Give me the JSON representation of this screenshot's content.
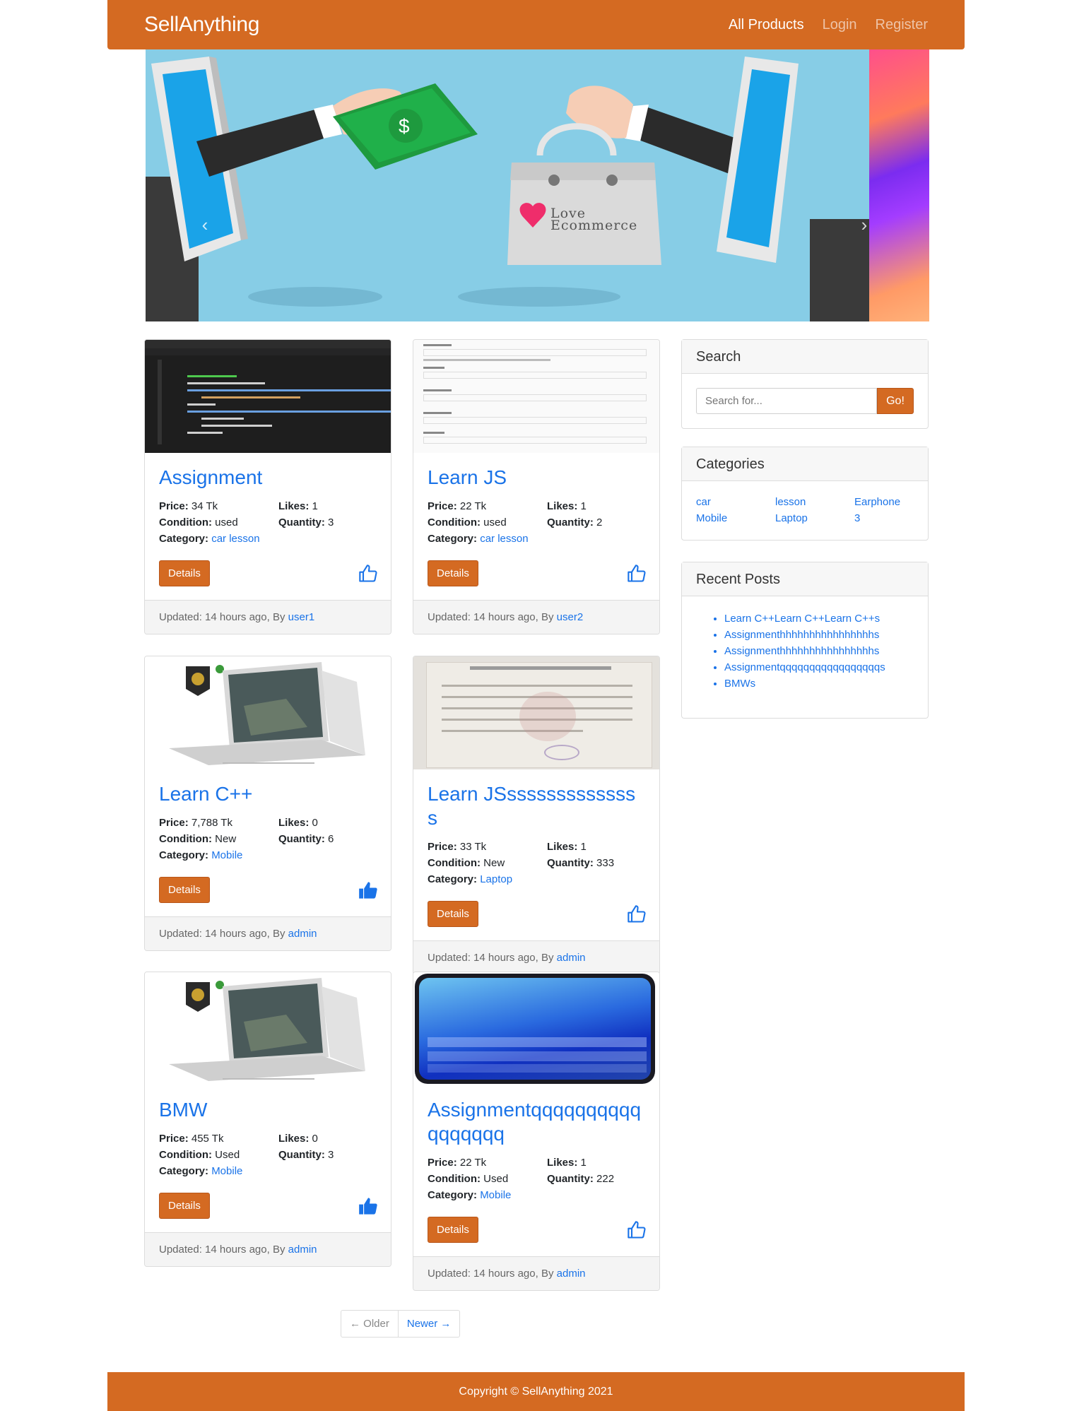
{
  "nav": {
    "brand": "SellAnything",
    "links": [
      "All Products",
      "Login",
      "Register"
    ]
  },
  "carousel": {
    "bag_text_line1": "Love",
    "bag_text_line2": "Ecommerce",
    "prev": "‹",
    "next": "›"
  },
  "labels": {
    "price": "Price:",
    "likes": "Likes:",
    "condition": "Condition:",
    "quantity": "Quantity:",
    "category": "Category:",
    "details": "Details",
    "updated_prefix": "Updated: 14 hours ago, By"
  },
  "products": [
    {
      "title": "Assignment",
      "price": "34 Tk",
      "likes": "1",
      "condition": "used",
      "quantity": "3",
      "category": "car lesson",
      "author": "user1",
      "liked": false,
      "image": "code-editor"
    },
    {
      "title": "Learn JS",
      "price": "22 Tk",
      "likes": "1",
      "condition": "used",
      "quantity": "2",
      "category": "car lesson",
      "author": "user2",
      "liked": false,
      "image": "signup-form"
    },
    {
      "title": "Learn C++",
      "price": "7,788 Tk",
      "likes": "0",
      "condition": "New",
      "quantity": "6",
      "category": "Mobile",
      "author": "admin",
      "liked": true,
      "image": "laptop"
    },
    {
      "title": "Learn JSssssssssssssss",
      "price": "33 Tk",
      "likes": "1",
      "condition": "New",
      "quantity": "333",
      "category": "Laptop",
      "author": "admin",
      "liked": false,
      "image": "certificate"
    },
    {
      "title": "BMW",
      "price": "455 Tk",
      "likes": "0",
      "condition": "Used",
      "quantity": "3",
      "category": "Mobile",
      "author": "admin",
      "liked": true,
      "image": "laptop"
    },
    {
      "title": "Assignmentqqqqqqqqqqqqqqqqq",
      "price": "22 Tk",
      "likes": "1",
      "condition": "Used",
      "quantity": "222",
      "category": "Mobile",
      "author": "admin",
      "liked": false,
      "image": "phone"
    }
  ],
  "sidebar": {
    "search": {
      "title": "Search",
      "placeholder": "Search for...",
      "button": "Go!"
    },
    "categories": {
      "title": "Categories",
      "items": [
        "car",
        "lesson",
        "Earphone",
        "Mobile",
        "Laptop",
        "3"
      ]
    },
    "recent": {
      "title": "Recent Posts",
      "items": [
        "Learn C++Learn C++Learn C++s",
        "Assignmenthhhhhhhhhhhhhhhhs",
        "Assignmenthhhhhhhhhhhhhhhhs",
        "Assignmentqqqqqqqqqqqqqqqqqs",
        "BMWs"
      ]
    }
  },
  "pager": {
    "older": "← Older",
    "newer": "Newer →"
  },
  "footer": {
    "text": "Copyright © SellAnything 2021"
  },
  "colors": {
    "brand": "#d46a22",
    "link": "#1a73e8",
    "carousel_bg": "#87cde6"
  }
}
